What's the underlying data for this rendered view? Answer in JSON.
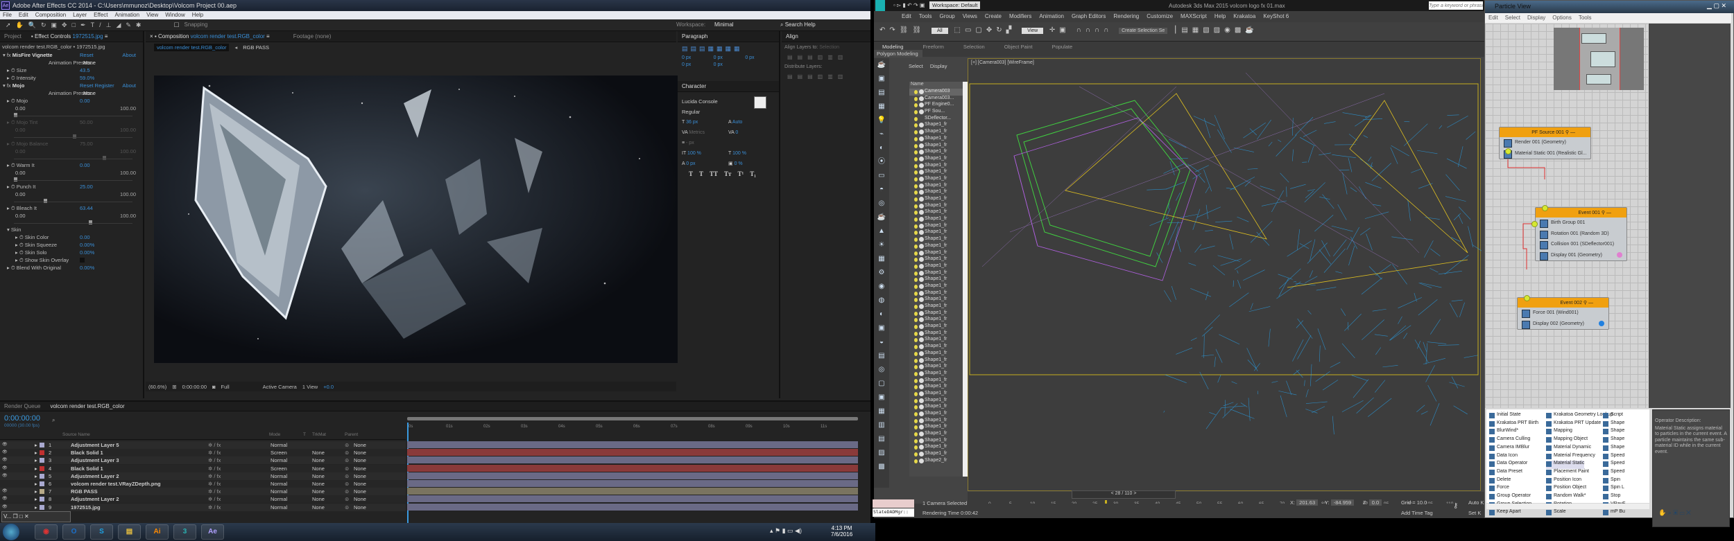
{
  "ae": {
    "title": "Adobe After Effects CC 2014 - C:\\Users\\mmunoz\\Desktop\\Volcom Project 00.aep",
    "menu": [
      "File",
      "Edit",
      "Composition",
      "Layer",
      "Effect",
      "Animation",
      "View",
      "Window",
      "Help"
    ],
    "snapping": "Snapping",
    "workspace_label": "Workspace:",
    "workspace": "Minimal",
    "search_help": "Search Help",
    "tabs": {
      "project": "Project",
      "effect_controls": "Effect Controls",
      "effect_controls_target": "1972515.jpg",
      "composition": "Composition",
      "composition_target": "volcom render test.RGB_color",
      "footage": "Footage (none)"
    },
    "ec_subtitle": "volcom render test.RGB_color • 1972515.jpg",
    "comp_breadcrumbs": [
      "volcom render test.RGB_color",
      "RGB PASS"
    ],
    "effect_rows": [
      {
        "type": "fx",
        "label": "MisFire Vignette",
        "v": "Reset",
        "r": "About"
      },
      {
        "type": "preset",
        "label": "Animation Presets:",
        "v": "None"
      },
      {
        "type": "prop",
        "label": "Size",
        "v": "43.5"
      },
      {
        "type": "prop",
        "label": "Intensity",
        "v": "59.0%"
      },
      {
        "type": "fx",
        "label": "Mojo",
        "v": "Reset  Register",
        "r": "About"
      },
      {
        "type": "preset",
        "label": "Animation Presets:",
        "v": "None"
      },
      {
        "type": "prop",
        "label": "Mojo",
        "v": "0.00"
      },
      {
        "type": "range",
        "label": "0.00",
        "r": "100.00",
        "knob": 0
      },
      {
        "type": "prop",
        "label": "Mojo Tint",
        "v": "50.00",
        "dim": true
      },
      {
        "type": "range",
        "label": "0.00",
        "r": "100.00",
        "knob": 50,
        "dim": true
      },
      {
        "type": "prop",
        "label": "Mojo Balance",
        "v": "75.00",
        "dim": true
      },
      {
        "type": "range",
        "label": "0.00",
        "r": "100.00",
        "knob": 75,
        "dim": true
      },
      {
        "type": "prop",
        "label": "Warm It",
        "v": "0.00"
      },
      {
        "type": "range",
        "label": "0.00",
        "r": "100.00",
        "knob": 0
      },
      {
        "type": "prop",
        "label": "Punch It",
        "v": "25.00"
      },
      {
        "type": "range",
        "label": "0.00",
        "r": "100.00",
        "knob": 25
      },
      {
        "type": "prop",
        "label": "Bleach It",
        "v": "63.44"
      },
      {
        "type": "range",
        "label": "0.00",
        "r": "100.00",
        "knob": 63.44
      },
      {
        "type": "group",
        "label": "Skin"
      },
      {
        "type": "sub",
        "label": "Skin Color",
        "v": "0.00"
      },
      {
        "type": "sub",
        "label": "Skin Squeeze",
        "v": "0.00%"
      },
      {
        "type": "sub",
        "label": "Skin Solo",
        "v": "0.00%"
      },
      {
        "type": "sub",
        "label": "Show Skin Overlay",
        "v": ""
      },
      {
        "type": "prop",
        "label": "Blend With Original",
        "v": "0.00%"
      }
    ],
    "paragraph": {
      "title": "Paragraph",
      "indents": [
        "0 px",
        "0 px",
        "0 px",
        "0 px",
        "0 px"
      ]
    },
    "character": {
      "title": "Character",
      "font": "Lucida Console",
      "style": "Regular",
      "size": "36 px",
      "leading": "Auto",
      "kerning": "Metrics",
      "tracking": "0",
      "stroke": "- px",
      "vscale": "100 %",
      "hscale": "100 %",
      "baseline": "0 px",
      "tsume": "0 %",
      "styles": [
        "T",
        "T",
        "TT",
        "Tт",
        "T¹",
        "T₁"
      ]
    },
    "align": {
      "title": "Align",
      "align_to_label": "Align Layers to:",
      "align_to": "Selection",
      "distribute_label": "Distribute Layers:"
    },
    "comp_bar": {
      "zoom": "(60.6%)",
      "time": "0:00:00:00",
      "resolution": "Full",
      "camera": "Active Camera",
      "views": "1 View",
      "exposure": "+0.0"
    },
    "timeline": {
      "tabs": [
        "Render Queue",
        "volcom render test.RGB_color"
      ],
      "timecode": "0:00:00:00",
      "fps": "00000 (30.00 fps)",
      "columns": [
        "Source Name",
        "Mode",
        "T",
        "TrkMat",
        "Parent"
      ],
      "ruler": [
        "0s",
        "01s",
        "02s",
        "03s",
        "04s",
        "05s",
        "06s",
        "07s",
        "08s",
        "09s",
        "10s",
        "11s"
      ],
      "layers": [
        {
          "n": "1",
          "name": "Adjustment Layer 5",
          "mode": "Normal",
          "trk": "",
          "parent": "None",
          "label": "#a9a9d0",
          "bar": "#6a6a86",
          "vis": true
        },
        {
          "n": "2",
          "name": "Black Solid 1",
          "mode": "Screen",
          "trk": "None",
          "parent": "None",
          "label": "#c03030",
          "bar": "#8a3a3a",
          "vis": true
        },
        {
          "n": "3",
          "name": "Adjustment Layer 3",
          "mode": "Normal",
          "trk": "None",
          "parent": "None",
          "label": "#a9a9d0",
          "bar": "#6a6a86",
          "vis": true
        },
        {
          "n": "4",
          "name": "Black Solid 1",
          "mode": "Screen",
          "trk": "None",
          "parent": "None",
          "label": "#c03030",
          "bar": "#8a3a3a",
          "vis": true
        },
        {
          "n": "5",
          "name": "Adjustment Layer 2",
          "mode": "Normal",
          "trk": "None",
          "parent": "None",
          "label": "#a9a9d0",
          "bar": "#6a6a86",
          "vis": true
        },
        {
          "n": "6",
          "name": "volcom render test.VRayZDepth.png",
          "mode": "Normal",
          "trk": "None",
          "parent": "None",
          "label": "#a9a9d0",
          "bar": "#6a6a86",
          "vis": false
        },
        {
          "n": "7",
          "name": "RGB PASS",
          "mode": "Normal",
          "trk": "None",
          "parent": "None",
          "label": "#b8aa88",
          "bar": "#7a7460",
          "vis": true
        },
        {
          "n": "8",
          "name": "Adjustment Layer 2",
          "mode": "Normal",
          "trk": "None",
          "parent": "None",
          "label": "#a9a9d0",
          "bar": "#6a6a86",
          "vis": true
        },
        {
          "n": "9",
          "name": "1972515.jpg",
          "mode": "Normal",
          "trk": "None",
          "parent": "None",
          "label": "#a9a9d0",
          "bar": "#6a6a86",
          "vis": true
        }
      ]
    }
  },
  "taskbar": {
    "apps": [
      {
        "name": "chrome",
        "glyph": "◉",
        "color": "#d33"
      },
      {
        "name": "outlook",
        "glyph": "O",
        "color": "#1a6fc9"
      },
      {
        "name": "skype",
        "glyph": "S",
        "color": "#1da1e2"
      },
      {
        "name": "explorer",
        "glyph": "▤",
        "color": "#e8c040"
      },
      {
        "name": "illustrator",
        "glyph": "Ai",
        "color": "#ff8a00"
      },
      {
        "name": "3ds-max",
        "glyph": "3",
        "color": "#2ab0b0"
      },
      {
        "name": "after-effects",
        "glyph": "Ae",
        "color": "#b0a0ff"
      }
    ],
    "minimized": "V...",
    "time": "4:13 PM",
    "date": "7/6/2016"
  },
  "max": {
    "title": "Autodesk 3ds Max 2015    volcom logo fx 01.max",
    "workspace": "Workspace: Default",
    "search_placeholder": "Type a keyword or phrase",
    "menu": [
      "Edit",
      "Tools",
      "Group",
      "Views",
      "Create",
      "Modifiers",
      "Animation",
      "Graph Editors",
      "Rendering",
      "Customize",
      "MAXScript",
      "Help",
      "Krakatoa",
      "KeyShot 6"
    ],
    "selection_filter": "All",
    "ref_coord": "View",
    "named_sel": "Create Selection Se",
    "ribbon_tabs": [
      "Modeling",
      "Freeform",
      "Selection",
      "Object Paint",
      "Populate"
    ],
    "ribbon_panel": "Polygon Modeling",
    "explorer_tabs": [
      "Select",
      "Display"
    ],
    "explorer_col": "Name",
    "explorer_items": [
      "Camera003",
      "Camera003...",
      "PF Engine0...",
      "PF Sou...",
      "SDeflector...",
      "Shape1_fr",
      "Shape1_fr",
      "Shape1_fr",
      "Shape1_fr",
      "Shape1_fr",
      "Shape1_fr",
      "Shape1_fr",
      "Shape1_fr",
      "Shape1_fr",
      "Shape1_fr",
      "Shape1_fr",
      "Shape1_fr",
      "Shape1_fr",
      "Shape1_fr",
      "Shape1_fr",
      "Shape1_fr",
      "Shape1_fr",
      "Shape1_fr",
      "Shape1_fr",
      "Shape1_fr",
      "Shape1_fr",
      "Shape1_fr",
      "Shape1_fr",
      "Shape1_fr",
      "Shape1_fr",
      "Shape1_fr",
      "Shape1_fr",
      "Shape1_fr",
      "Shape1_fr",
      "Shape1_fr",
      "Shape1_fr",
      "Shape1_fr",
      "Shape1_fr",
      "Shape1_fr",
      "Shape1_fr",
      "Shape1_fr",
      "Shape1_fr",
      "Shape1_fr",
      "Shape1_fr",
      "Shape1_fr",
      "Shape1_fr",
      "Shape1_fr",
      "Shape1_fr",
      "Shape1_fr",
      "Shape1_fr",
      "Shape1_fr",
      "Shape1_fr",
      "Shape1_fr",
      "Shape1_fr",
      "Shape1_fr",
      "Shape2_fr"
    ],
    "viewport_label": "[+] [Camera003] [WireFrame]",
    "frame": "28 / 110",
    "frame_value": 28,
    "frame_max": 110,
    "timeline_ticks": [
      "0",
      "5",
      "10",
      "15",
      "20",
      "25",
      "30",
      "35",
      "40",
      "45",
      "50",
      "55",
      "60",
      "65",
      "70",
      "75",
      "80",
      "85",
      "90",
      "95",
      "100",
      "105",
      "110"
    ],
    "status": "1 Camera Selected",
    "render_time": "Rendering Time  0:00:42",
    "maxscript": "SlateDADMgr::",
    "x": "201.63",
    "y": "-84.959",
    "z": "0.0",
    "grid": "Grid = 10.0",
    "add_time_tag": "Add Time Tag",
    "auto_key": "Auto K",
    "set_key": "Set K"
  },
  "pv": {
    "title": "Particle View",
    "menu": [
      "Edit",
      "Select",
      "Display",
      "Options",
      "Tools"
    ],
    "nodes": [
      {
        "title": "PF Source 001",
        "ops": [
          "Render 001 (Geometry)",
          "Material Static 001 (Realistic Gl..."
        ]
      },
      {
        "title": "Event 001",
        "ops": [
          "Birth Group 001",
          "Rotation 001 (Random 3D)",
          "Collision 001 (SDeflector001)",
          "Display 001 (Geometry)"
        ]
      },
      {
        "title": "Event 002",
        "ops": [
          "Force 001 (Wind001)",
          "Display 002 (Geometry)"
        ]
      }
    ],
    "depot": [
      [
        "Initial State",
        "Krakatoa PRT Birth",
        "BlurWind*",
        "Camera Culling",
        "Camera IMBlur",
        "Data Icon",
        "Data Operator",
        "Data Preset",
        "Delete",
        "Force",
        "Group Operator",
        "Group Selection",
        "Keep Apart"
      ],
      [
        "Krakatoa Geometry Lookup",
        "Krakatoa PRT Update",
        "Mapping",
        "Mapping Object",
        "Material Dynamic",
        "Material Frequency",
        "Material Static",
        "Placement Paint",
        "Position Icon",
        "Position Object",
        "Random Walk*",
        "Rotation",
        "Scale"
      ],
      [
        "Script",
        "Shape",
        "Shape",
        "Shape",
        "Shape",
        "Speed",
        "Speed",
        "Speed",
        "Spin",
        "Spin L",
        "Stop",
        "VRayF",
        "mP Bu"
      ]
    ],
    "selected_depot": "Material Static",
    "desc_title": "Operator Description:",
    "desc": "Material Static assigns material to particles in the current event.  A particle maintains the same sub-material ID while in the current event.",
    "display_colors": [
      "#e080d0",
      "#2080e0"
    ]
  }
}
